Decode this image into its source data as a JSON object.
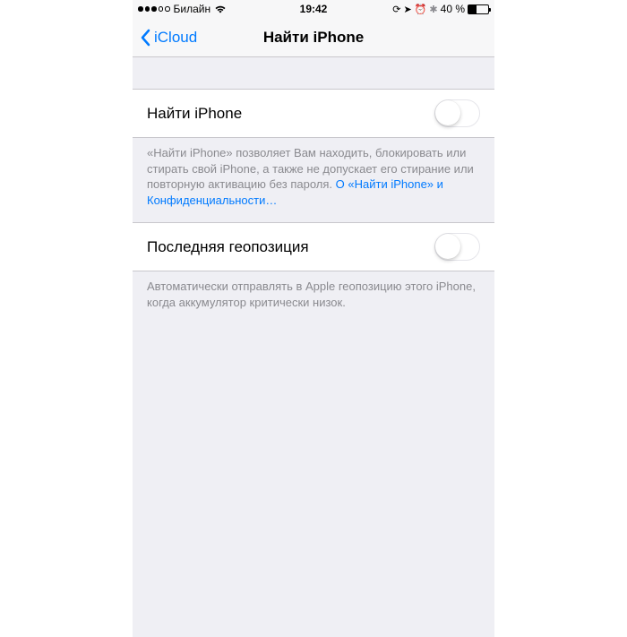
{
  "statusBar": {
    "carrier": "Билайн",
    "time": "19:42",
    "batteryPercent": "40 %"
  },
  "nav": {
    "backLabel": "iCloud",
    "title": "Найти iPhone"
  },
  "rows": {
    "findIphone": {
      "label": "Найти iPhone",
      "footerText": "«Найти iPhone» позволяет Вам находить, блокировать или стирать свой iPhone, а также не допускает его стирание или повторную активацию без пароля. ",
      "footerLink": "О «Найти iPhone» и Конфиденциальности…"
    },
    "lastLocation": {
      "label": "Последняя геопозиция",
      "footerText": "Автоматически отправлять в Apple геопозицию этого iPhone, когда аккумулятор критически низок."
    }
  }
}
